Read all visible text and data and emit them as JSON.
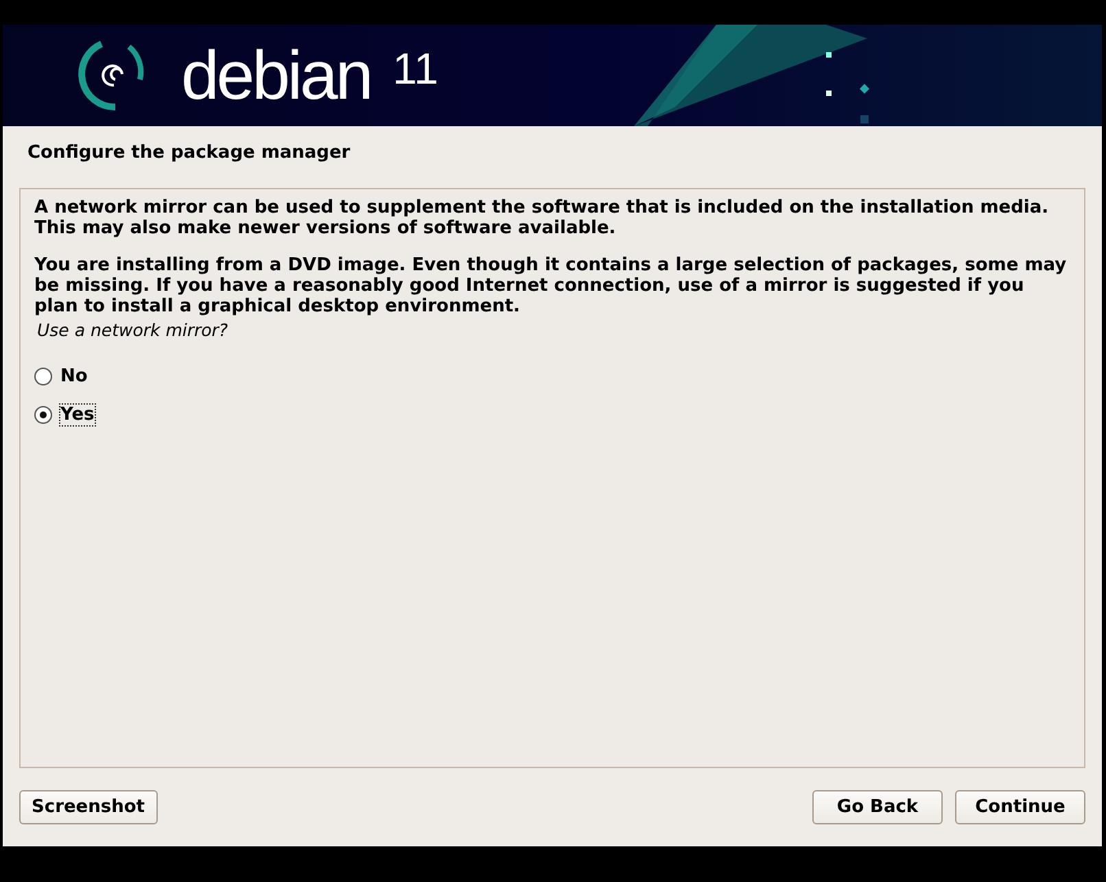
{
  "banner": {
    "logo_text": "debian",
    "version": "11"
  },
  "title": "Configure the package manager",
  "paragraphs": [
    "A network mirror can be used to supplement the software that is included on the installation media. This may also make newer versions of software available.",
    "You are installing from a DVD image. Even though it contains a large selection of packages, some may be missing. If you have a reasonably good Internet connection, use of a mirror is suggested if you plan to install a graphical desktop environment."
  ],
  "question": "Use a network mirror?",
  "options": [
    {
      "label": "No",
      "selected": false
    },
    {
      "label": "Yes",
      "selected": true
    }
  ],
  "buttons": {
    "left": [
      "Screenshot"
    ],
    "right": [
      "Go Back",
      "Continue"
    ]
  }
}
